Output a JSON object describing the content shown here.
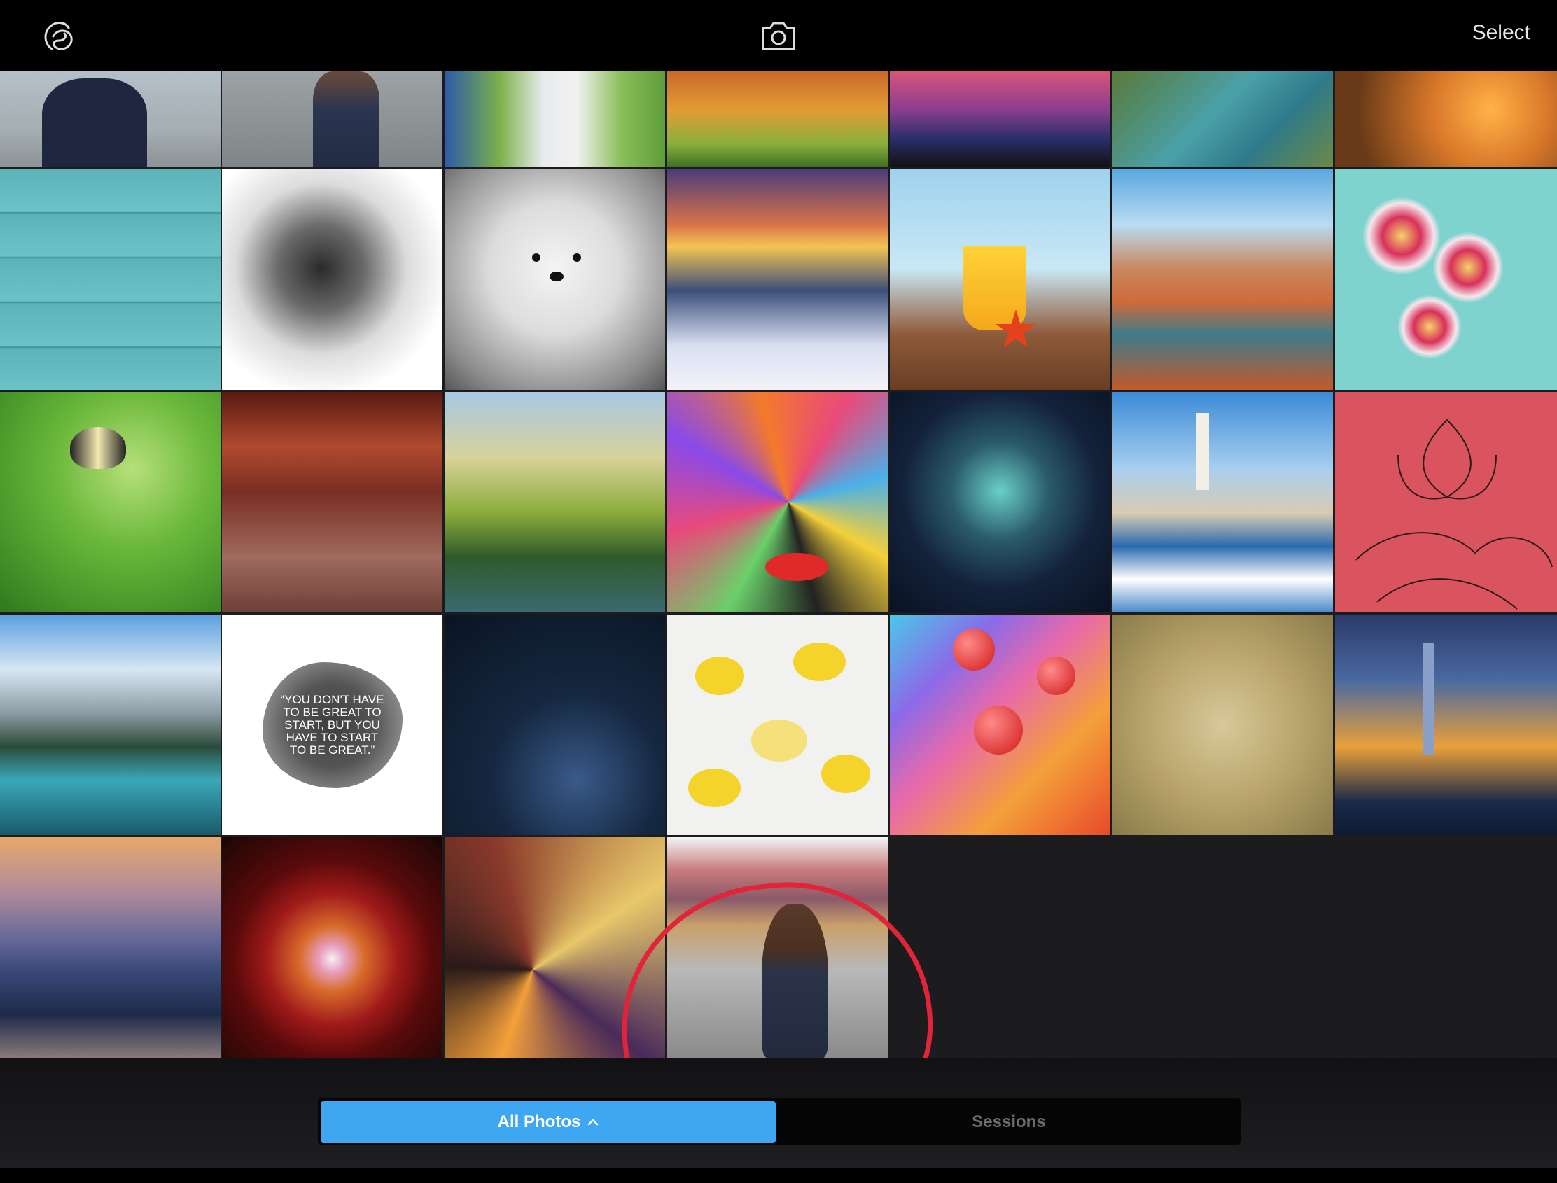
{
  "header": {
    "select_label": "Select"
  },
  "quote_tile": {
    "text": "“YOU DON'T HAVE TO BE GREAT TO START, BUT YOU HAVE TO START TO BE GREAT.”"
  },
  "tabs": {
    "all_photos_label": "All Photos",
    "sessions_label": "Sessions"
  },
  "colors": {
    "accent": "#3fa7f2",
    "highlight": "#e0243a"
  },
  "icons": [
    "app-logo-icon",
    "camera-icon",
    "chevron-up-icon"
  ]
}
